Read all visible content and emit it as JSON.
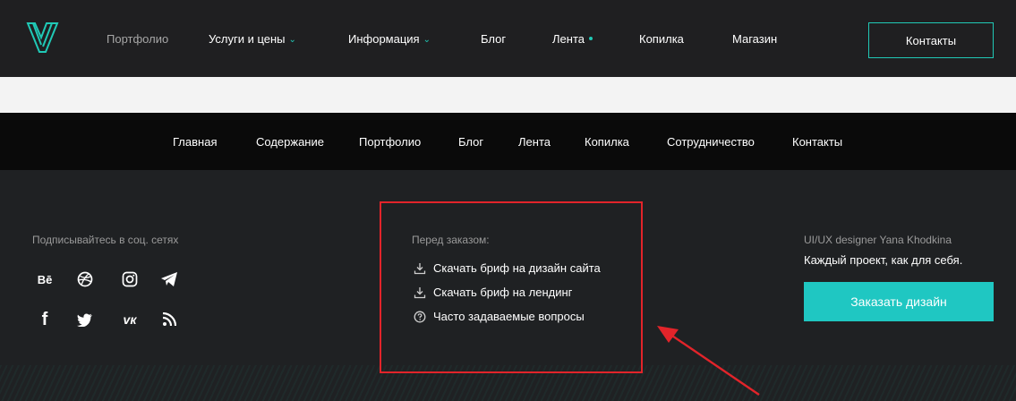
{
  "header": {
    "nav": [
      {
        "label": "Портфолио"
      },
      {
        "label": "Услуги и цены"
      },
      {
        "label": "Информация"
      },
      {
        "label": "Блог"
      },
      {
        "label": "Лента"
      },
      {
        "label": "Копилка"
      },
      {
        "label": "Магазин"
      }
    ],
    "contact_button": "Контакты"
  },
  "footer_nav": [
    {
      "label": "Главная"
    },
    {
      "label": "Содержание"
    },
    {
      "label": "Портфолио"
    },
    {
      "label": "Блог"
    },
    {
      "label": "Лента"
    },
    {
      "label": "Копилка"
    },
    {
      "label": "Сотрудничество"
    },
    {
      "label": "Контакты"
    }
  ],
  "footer": {
    "social_title": "Подписывайтесь в соц. сетях",
    "social": [
      {
        "icon": "behance-icon",
        "text": "Bē"
      },
      {
        "icon": "dribbble-icon",
        "text": ""
      },
      {
        "icon": "instagram-icon",
        "text": ""
      },
      {
        "icon": "telegram-icon",
        "text": ""
      },
      {
        "icon": "facebook-icon",
        "text": "f"
      },
      {
        "icon": "twitter-icon",
        "text": ""
      },
      {
        "icon": "vk-icon",
        "text": "vк"
      },
      {
        "icon": "rss-icon",
        "text": ""
      }
    ],
    "before_order_title": "Перед заказом:",
    "links": [
      {
        "icon": "download-icon",
        "label": "Скачать бриф на дизайн сайта"
      },
      {
        "icon": "download-icon",
        "label": "Скачать бриф на лендинг"
      },
      {
        "icon": "question-icon",
        "label": "Часто задаваемые вопросы"
      }
    ],
    "designer_title": "UI/UX designer Yana Khodkina",
    "slogan": "Каждый проект, как для себя.",
    "order_button": "Заказать дизайн"
  },
  "colors": {
    "accent": "#20c9b6",
    "highlight": "#e2242a",
    "header_bg": "#1f1f21",
    "footer_bg": "#1f2123",
    "footer_nav_bg": "#0a0a0a"
  }
}
